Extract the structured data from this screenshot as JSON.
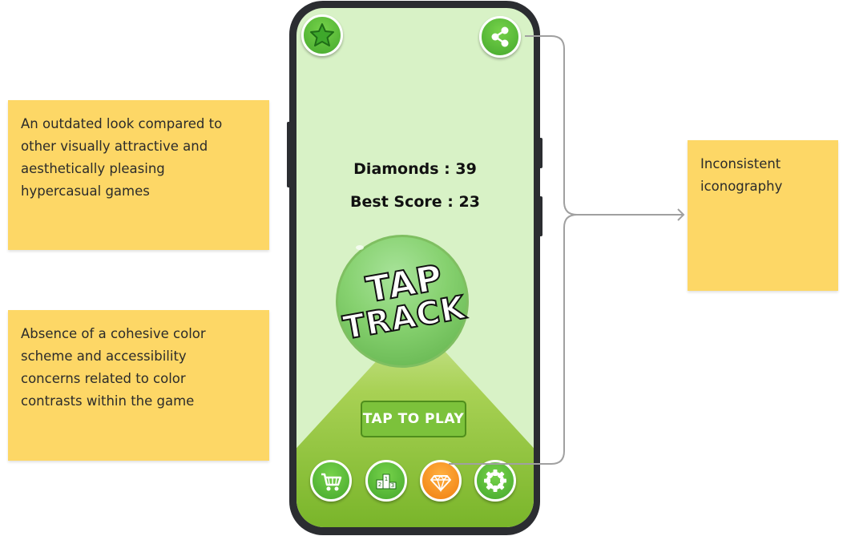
{
  "annotations": {
    "outdated_look": [
      "An outdated look compared to",
      "other visually attractive and",
      "aesthetically pleasing",
      "hypercasual games"
    ],
    "color_scheme": [
      "Absence of a cohesive color",
      "scheme and accessibility",
      "concerns related to color",
      "contrasts within the game"
    ],
    "iconography": [
      "Inconsistent",
      "iconography"
    ]
  },
  "game": {
    "diamonds_label": "Diamonds : 39",
    "best_score_label": "Best Score : 23",
    "logo_line1": "TAP",
    "logo_line2": "TRACK",
    "play_button": "TAP TO PLAY"
  },
  "icons": {
    "top_left": "star-icon",
    "top_right": "share-icon",
    "bottom": [
      "cart-icon",
      "leaderboard-icon",
      "diamond-icon",
      "settings-icon"
    ]
  },
  "colors": {
    "sticky_note": "#fdd766",
    "screen_bg": "#d8f2c6",
    "button_green": "#45a82d",
    "button_orange": "#f07e10",
    "connector": "#9e9e9e"
  }
}
